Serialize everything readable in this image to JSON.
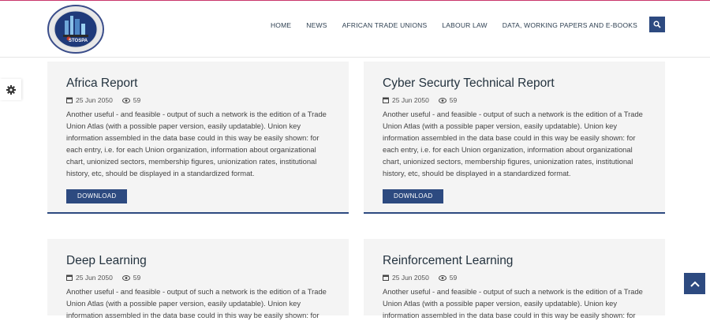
{
  "header": {
    "logo_text": "STOSPA",
    "nav": [
      "HOME",
      "NEWS",
      "AFRICAN TRADE UNIONS",
      "LABOUR LAW",
      "DATA, WORKING PAPERS AND E-BOOKS"
    ]
  },
  "cards": [
    {
      "title": "Africa Report",
      "date": "25 Jun 2050",
      "views": "59",
      "body": "Another useful - and feasible - output of such a network is the edition of a Trade Union Atlas (with a possible paper version, easily updatable). Union key information assembled in the data base could in this way be easily shown: for each entry, i.e. for each Union organization, information about organizational chart, unionized sectors, membership figures, unionization rates, institutional history, etc, should be displayed in a standardized format.",
      "button": "DOWNLOAD"
    },
    {
      "title": "Cyber Securty Technical Report",
      "date": "25 Jun 2050",
      "views": "59",
      "body": "Another useful - and feasible - output of such a network is the edition of a Trade Union Atlas (with a possible paper version, easily updatable). Union key information assembled in the data base could in this way be easily shown: for each entry, i.e. for each Union organization, information about organizational chart, unionized sectors, membership figures, unionization rates, institutional history, etc, should be displayed in a standardized format.",
      "button": "DOWNLOAD"
    },
    {
      "title": "Deep Learning",
      "date": "25 Jun 2050",
      "views": "59",
      "body": "Another useful - and feasible - output of such a network is the edition of a Trade Union Atlas (with a possible paper version, easily updatable). Union key information assembled in the data base could in this way be easily shown: for"
    },
    {
      "title": "Reinforcement Learning",
      "date": "25 Jun 2050",
      "views": "59",
      "body": "Another useful - and feasible - output of such a network is the edition of a Trade Union Atlas (with a possible paper version, easily updatable). Union key information assembled in the data base could in this way be easily shown: for"
    }
  ],
  "colors": {
    "accent": "#2d4a80",
    "card_bg": "#f4f4f4",
    "title": "#24333f",
    "top_line": "#c9356b"
  }
}
